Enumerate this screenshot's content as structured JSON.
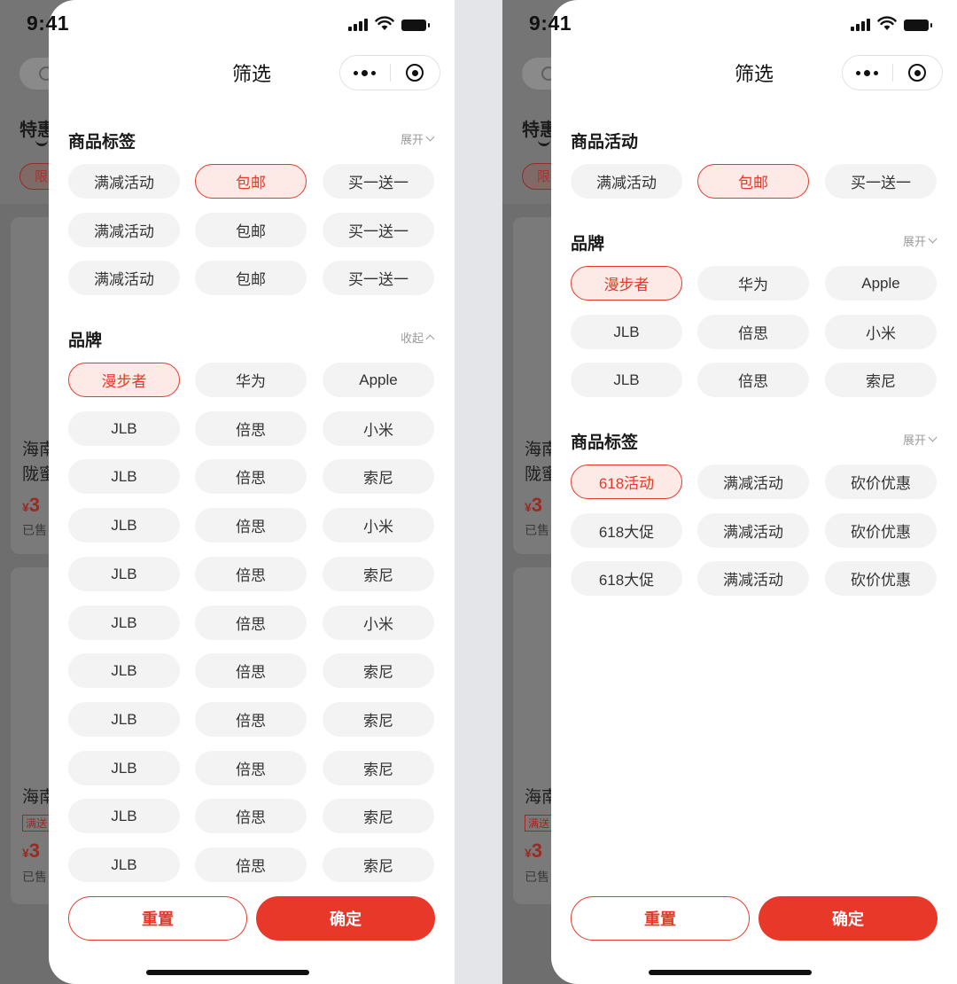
{
  "status_bar": {
    "time": "9:41"
  },
  "background": {
    "tab": "特惠",
    "chip": "限",
    "item1_line1": "海南",
    "item1_line2": "陇蜜",
    "price_symbol": "¥",
    "price": "3",
    "sold": "已售",
    "item2_line1": "海南",
    "item2_tag": "满送"
  },
  "left": {
    "title": "筛选",
    "sections": [
      {
        "title": "商品标签",
        "toggle": "展开",
        "chips": [
          "满减活动",
          "包邮",
          "买一送一",
          "满减活动",
          "包邮",
          "买一送一",
          "满减活动",
          "包邮",
          "买一送一"
        ]
      },
      {
        "title": "品牌",
        "toggle": "收起",
        "chips": [
          "漫步者",
          "华为",
          "Apple",
          "JLB",
          "倍思",
          "小米",
          "JLB",
          "倍思",
          "索尼",
          "JLB",
          "倍思",
          "小米",
          "JLB",
          "倍思",
          "索尼",
          "JLB",
          "倍思",
          "小米",
          "JLB",
          "倍思",
          "索尼",
          "JLB",
          "倍思",
          "索尼",
          "JLB",
          "倍思",
          "索尼",
          "JLB",
          "倍思",
          "索尼",
          "JLB",
          "倍思",
          "索尼"
        ]
      }
    ],
    "reset_label": "重置",
    "confirm_label": "确定"
  },
  "right": {
    "title": "筛选",
    "sections": [
      {
        "title": "商品活动",
        "toggle": "",
        "chips": [
          "满减活动",
          "包邮",
          "买一送一"
        ]
      },
      {
        "title": "品牌",
        "toggle": "展开",
        "chips": [
          "漫步者",
          "华为",
          "Apple",
          "JLB",
          "倍思",
          "小米",
          "JLB",
          "倍思",
          "索尼"
        ]
      },
      {
        "title": "商品标签",
        "toggle": "展开",
        "chips": [
          "618活动",
          "满减活动",
          "砍价优惠",
          "618大促",
          "满减活动",
          "砍价优惠",
          "618大促",
          "满减活动",
          "砍价优惠"
        ]
      }
    ],
    "reset_label": "重置",
    "confirm_label": "确定"
  },
  "colors": {
    "accent": "#e8382a",
    "chip_bg": "#f3f3f3",
    "active_bg": "#fdeae7"
  }
}
